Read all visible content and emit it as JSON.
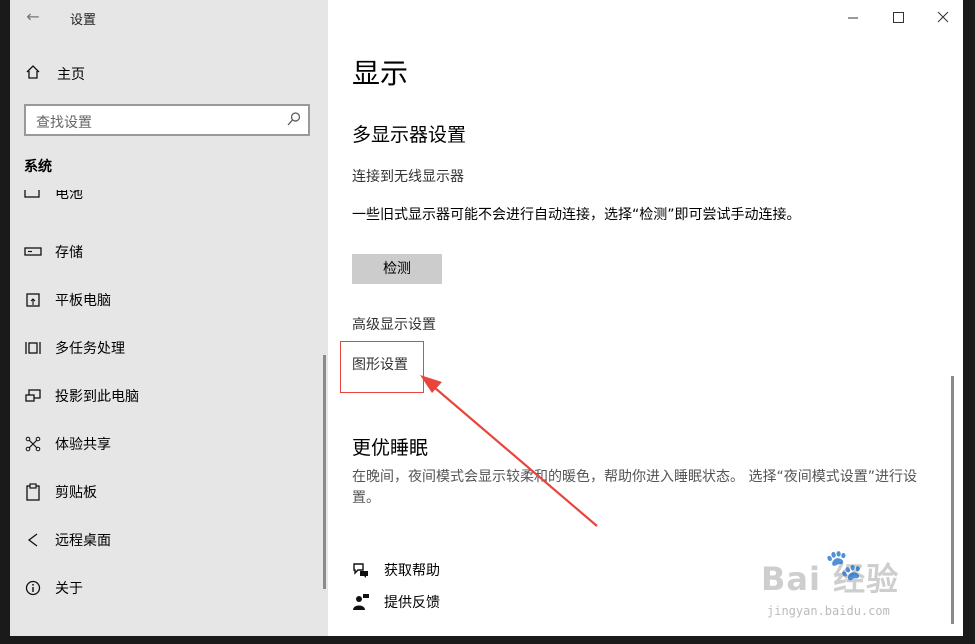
{
  "window": {
    "title": "设置",
    "back_glyph": "←",
    "min_glyph": "—",
    "max_glyph": "☐",
    "close_glyph": "✕"
  },
  "sidebar": {
    "home_label": "主页",
    "search_placeholder": "查找设置",
    "section_label": "系统",
    "items": [
      {
        "label": "电池",
        "icon": "battery-icon"
      },
      {
        "label": "存储",
        "icon": "storage-icon"
      },
      {
        "label": "平板电脑",
        "icon": "tablet-icon"
      },
      {
        "label": "多任务处理",
        "icon": "multitasking-icon"
      },
      {
        "label": "投影到此电脑",
        "icon": "project-icon"
      },
      {
        "label": "体验共享",
        "icon": "share-icon"
      },
      {
        "label": "剪贴板",
        "icon": "clipboard-icon"
      },
      {
        "label": "远程桌面",
        "icon": "remote-desktop-icon"
      },
      {
        "label": "关于",
        "icon": "info-icon"
      }
    ]
  },
  "main": {
    "page_title": "显示",
    "multi_display_heading": "多显示器设置",
    "wireless_link": "连接到无线显示器",
    "detect_description": "一些旧式显示器可能不会进行自动连接，选择“检测”即可尝试手动连接。",
    "detect_button": "检测",
    "advanced_link": "高级显示设置",
    "graphics_link": "图形设置",
    "sleep_heading": "更优睡眠",
    "sleep_description": "在晚间，夜间模式会显示较柔和的暖色，帮助你进入睡眠状态。 选择“夜间模式设置”进行设置。",
    "help_label": "获取帮助",
    "feedback_label": "提供反馈"
  },
  "watermark": {
    "brand": "Bai  经验",
    "paw": "🐾",
    "url": "jingyan.baidu.com"
  },
  "colors": {
    "sidebar_bg": "#e6e6e6",
    "highlight_red": "#e8453c",
    "button_gray": "#cccccc"
  }
}
